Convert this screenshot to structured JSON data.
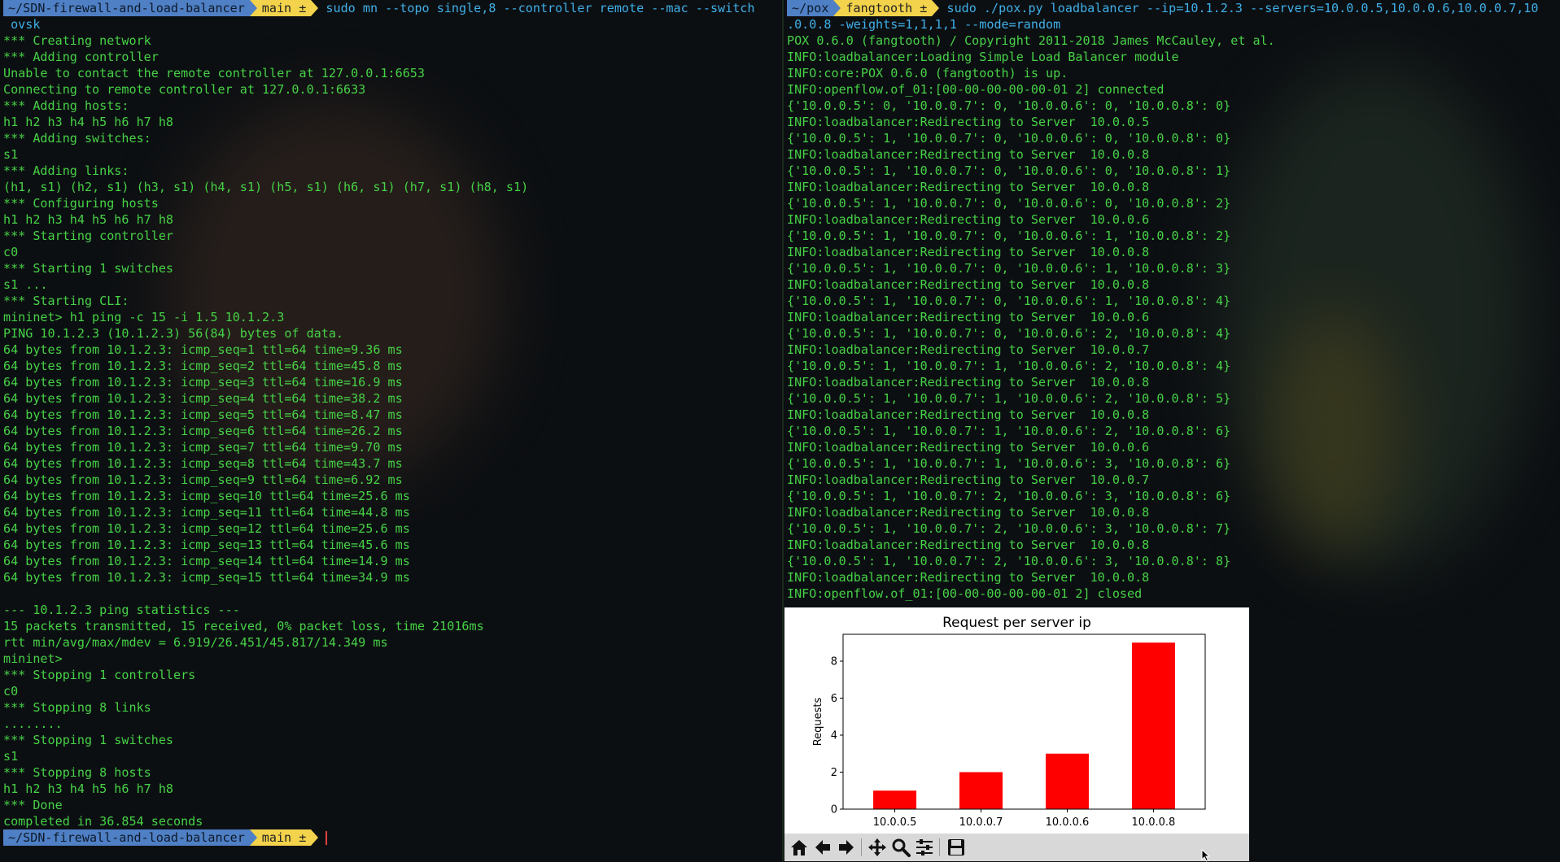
{
  "left_terminal": {
    "prompt": {
      "path": "~/SDN-firewall-and-load-balancer",
      "branch": "main ±"
    },
    "command": "sudo mn --topo single,8 --controller remote --mac --switch",
    "command_wrap": " ovsk",
    "lines": [
      "*** Creating network",
      "*** Adding controller",
      "Unable to contact the remote controller at 127.0.0.1:6653",
      "Connecting to remote controller at 127.0.0.1:6633",
      "*** Adding hosts:",
      "h1 h2 h3 h4 h5 h6 h7 h8",
      "*** Adding switches:",
      "s1",
      "*** Adding links:",
      "(h1, s1) (h2, s1) (h3, s1) (h4, s1) (h5, s1) (h6, s1) (h7, s1) (h8, s1)",
      "*** Configuring hosts",
      "h1 h2 h3 h4 h5 h6 h7 h8",
      "*** Starting controller",
      "c0",
      "*** Starting 1 switches",
      "s1 ...",
      "*** Starting CLI:",
      "mininet> h1 ping -c 15 -i 1.5 10.1.2.3",
      "PING 10.1.2.3 (10.1.2.3) 56(84) bytes of data.",
      "64 bytes from 10.1.2.3: icmp_seq=1 ttl=64 time=9.36 ms",
      "64 bytes from 10.1.2.3: icmp_seq=2 ttl=64 time=45.8 ms",
      "64 bytes from 10.1.2.3: icmp_seq=3 ttl=64 time=16.9 ms",
      "64 bytes from 10.1.2.3: icmp_seq=4 ttl=64 time=38.2 ms",
      "64 bytes from 10.1.2.3: icmp_seq=5 ttl=64 time=8.47 ms",
      "64 bytes from 10.1.2.3: icmp_seq=6 ttl=64 time=26.2 ms",
      "64 bytes from 10.1.2.3: icmp_seq=7 ttl=64 time=9.70 ms",
      "64 bytes from 10.1.2.3: icmp_seq=8 ttl=64 time=43.7 ms",
      "64 bytes from 10.1.2.3: icmp_seq=9 ttl=64 time=6.92 ms",
      "64 bytes from 10.1.2.3: icmp_seq=10 ttl=64 time=25.6 ms",
      "64 bytes from 10.1.2.3: icmp_seq=11 ttl=64 time=44.8 ms",
      "64 bytes from 10.1.2.3: icmp_seq=12 ttl=64 time=25.6 ms",
      "64 bytes from 10.1.2.3: icmp_seq=13 ttl=64 time=45.6 ms",
      "64 bytes from 10.1.2.3: icmp_seq=14 ttl=64 time=14.9 ms",
      "64 bytes from 10.1.2.3: icmp_seq=15 ttl=64 time=34.9 ms",
      "",
      "--- 10.1.2.3 ping statistics ---",
      "15 packets transmitted, 15 received, 0% packet loss, time 21016ms",
      "rtt min/avg/max/mdev = 6.919/26.451/45.817/14.349 ms",
      "mininet>",
      "*** Stopping 1 controllers",
      "c0",
      "*** Stopping 8 links",
      "........",
      "*** Stopping 1 switches",
      "s1",
      "*** Stopping 8 hosts",
      "h1 h2 h3 h4 h5 h6 h7 h8",
      "*** Done",
      "completed in 36.854 seconds"
    ],
    "final_prompt": {
      "path": "~/SDN-firewall-and-load-balancer",
      "branch": "main ±"
    }
  },
  "right_terminal": {
    "prompt": {
      "path": "~/pox",
      "branch": "fangtooth ±"
    },
    "command": "sudo ./pox.py loadbalancer --ip=10.1.2.3 --servers=10.0.0.5,10.0.0.6,10.0.0.7,10",
    "command_wrap": ".0.0.8 -weights=1,1,1,1 --mode=random",
    "lines": [
      "POX 0.6.0 (fangtooth) / Copyright 2011-2018 James McCauley, et al.",
      "INFO:loadbalancer:Loading Simple Load Balancer module",
      "INFO:core:POX 0.6.0 (fangtooth) is up.",
      "INFO:openflow.of_01:[00-00-00-00-00-01 2] connected",
      "{'10.0.0.5': 0, '10.0.0.7': 0, '10.0.0.6': 0, '10.0.0.8': 0}",
      "INFO:loadbalancer:Redirecting to Server  10.0.0.5",
      "{'10.0.0.5': 1, '10.0.0.7': 0, '10.0.0.6': 0, '10.0.0.8': 0}",
      "INFO:loadbalancer:Redirecting to Server  10.0.0.8",
      "{'10.0.0.5': 1, '10.0.0.7': 0, '10.0.0.6': 0, '10.0.0.8': 1}",
      "INFO:loadbalancer:Redirecting to Server  10.0.0.8",
      "{'10.0.0.5': 1, '10.0.0.7': 0, '10.0.0.6': 0, '10.0.0.8': 2}",
      "INFO:loadbalancer:Redirecting to Server  10.0.0.6",
      "{'10.0.0.5': 1, '10.0.0.7': 0, '10.0.0.6': 1, '10.0.0.8': 2}",
      "INFO:loadbalancer:Redirecting to Server  10.0.0.8",
      "{'10.0.0.5': 1, '10.0.0.7': 0, '10.0.0.6': 1, '10.0.0.8': 3}",
      "INFO:loadbalancer:Redirecting to Server  10.0.0.8",
      "{'10.0.0.5': 1, '10.0.0.7': 0, '10.0.0.6': 1, '10.0.0.8': 4}",
      "INFO:loadbalancer:Redirecting to Server  10.0.0.6",
      "{'10.0.0.5': 1, '10.0.0.7': 0, '10.0.0.6': 2, '10.0.0.8': 4}",
      "INFO:loadbalancer:Redirecting to Server  10.0.0.7",
      "{'10.0.0.5': 1, '10.0.0.7': 1, '10.0.0.6': 2, '10.0.0.8': 4}",
      "INFO:loadbalancer:Redirecting to Server  10.0.0.8",
      "{'10.0.0.5': 1, '10.0.0.7': 1, '10.0.0.6': 2, '10.0.0.8': 5}",
      "INFO:loadbalancer:Redirecting to Server  10.0.0.8",
      "{'10.0.0.5': 1, '10.0.0.7': 1, '10.0.0.6': 2, '10.0.0.8': 6}",
      "INFO:loadbalancer:Redirecting to Server  10.0.0.6",
      "{'10.0.0.5': 1, '10.0.0.7': 1, '10.0.0.6': 3, '10.0.0.8': 6}",
      "INFO:loadbalancer:Redirecting to Server  10.0.0.7",
      "{'10.0.0.5': 1, '10.0.0.7': 2, '10.0.0.6': 3, '10.0.0.8': 6}",
      "INFO:loadbalancer:Redirecting to Server  10.0.0.8",
      "{'10.0.0.5': 1, '10.0.0.7': 2, '10.0.0.6': 3, '10.0.0.8': 7}",
      "INFO:loadbalancer:Redirecting to Server  10.0.0.8",
      "{'10.0.0.5': 1, '10.0.0.7': 2, '10.0.0.6': 3, '10.0.0.8': 8}",
      "INFO:loadbalancer:Redirecting to Server  10.0.0.8",
      "INFO:openflow.of_01:[00-00-00-00-00-01 2] closed"
    ]
  },
  "plot_window": {
    "toolbar": [
      {
        "name": "home-icon"
      },
      {
        "name": "back-arrow-icon"
      },
      {
        "name": "forward-arrow-icon"
      },
      {
        "name": "pan-icon"
      },
      {
        "name": "zoom-icon"
      },
      {
        "name": "configure-subplots-icon"
      },
      {
        "name": "save-icon"
      }
    ]
  },
  "chart_data": {
    "type": "bar",
    "title": "Request per server ip",
    "xlabel": "",
    "ylabel": "Requests",
    "categories": [
      "10.0.0.5",
      "10.0.0.7",
      "10.0.0.6",
      "10.0.0.8"
    ],
    "values": [
      1,
      2,
      3,
      9
    ],
    "ylim": [
      0,
      9.45
    ],
    "yticks": [
      0,
      2,
      4,
      6,
      8
    ],
    "bar_color": "#ff0000",
    "grid": false
  },
  "colors": {
    "terminal_text": "#46d246",
    "command_text": "#3fb0e8",
    "prompt_path_bg": "#4f7fc4",
    "prompt_git_bg": "#f3d34b"
  }
}
